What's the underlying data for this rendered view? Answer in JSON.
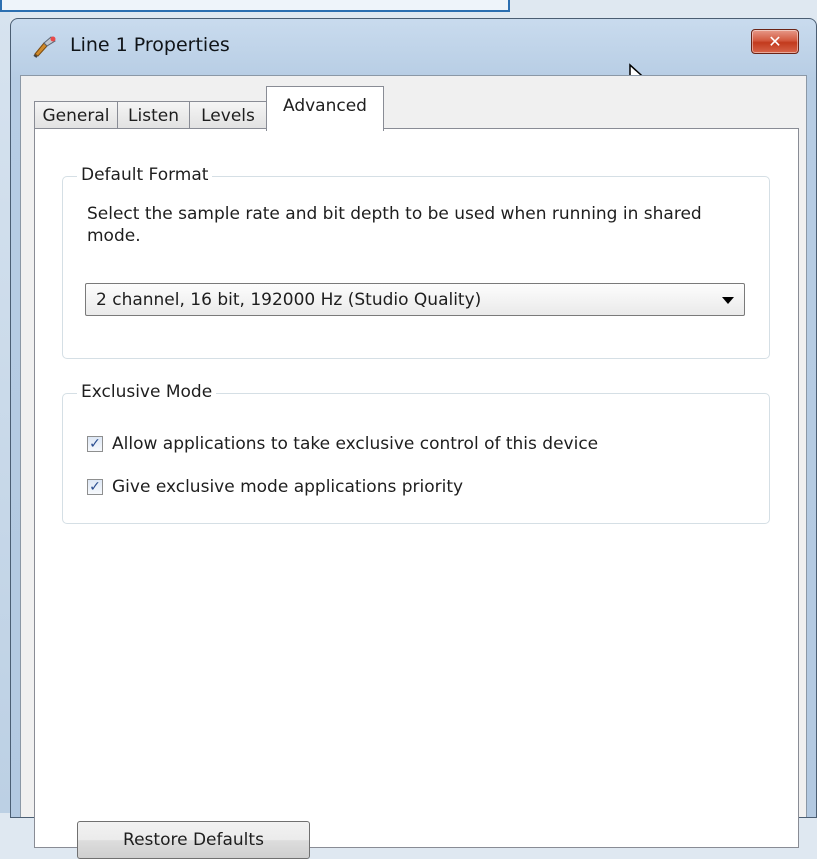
{
  "window": {
    "title": "Line 1 Properties",
    "close_glyph": "✕",
    "icon": "speaker-jack-icon"
  },
  "tabs": [
    {
      "label": "General",
      "active": false
    },
    {
      "label": "Listen",
      "active": false
    },
    {
      "label": "Levels",
      "active": false
    },
    {
      "label": "Advanced",
      "active": true
    }
  ],
  "default_format": {
    "title": "Default Format",
    "description": "Select the sample rate and bit depth to be used when running in shared mode.",
    "selected_format": "2 channel, 16 bit, 192000 Hz (Studio Quality)"
  },
  "exclusive_mode": {
    "title": "Exclusive Mode",
    "options": [
      {
        "label": "Allow applications to take exclusive control of this device",
        "checked": true
      },
      {
        "label": "Give exclusive mode applications priority",
        "checked": true
      }
    ]
  },
  "restore_button": {
    "label": "Restore Defaults"
  },
  "colors": {
    "close_button": "#c23a1d",
    "title_bar": "#b7cde4",
    "check_mark": "#2a4d8f"
  }
}
